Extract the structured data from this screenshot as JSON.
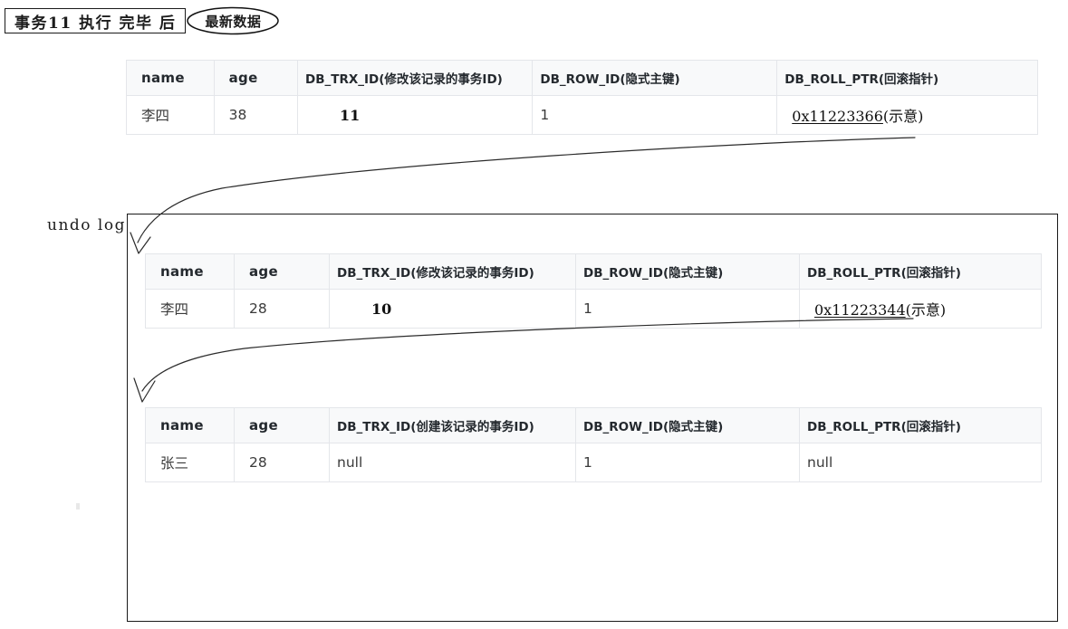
{
  "caption": {
    "boxed_text": "事务11 执行 完毕 后",
    "highlight_text": "最新数据"
  },
  "undo_log": {
    "label": "undo log"
  },
  "tables": {
    "current": {
      "name": "current-record-table",
      "headers": {
        "name": "name",
        "age": "age",
        "trx_id": "DB_TRX_ID(修改该记录的事务ID)",
        "row_id": "DB_ROW_ID(隐式主键)",
        "roll_ptr": "DB_ROLL_PTR(回滚指针)"
      },
      "row": {
        "name": "李四",
        "age": "38",
        "trx_id": "11",
        "row_id": "1",
        "roll_ptr_link": "0x11223366",
        "roll_ptr_note": "(示意)"
      }
    },
    "undo_1": {
      "name": "undo-log-record-table-1",
      "headers": {
        "name": "name",
        "age": "age",
        "trx_id": "DB_TRX_ID(修改该记录的事务ID)",
        "row_id": "DB_ROW_ID(隐式主键)",
        "roll_ptr": "DB_ROLL_PTR(回滚指针)"
      },
      "row": {
        "name": "李四",
        "age": "28",
        "trx_id": "10",
        "row_id": "1",
        "roll_ptr_link": "0x11223344",
        "roll_ptr_note": "(示意)"
      }
    },
    "undo_2": {
      "name": "undo-log-record-table-2",
      "headers": {
        "name": "name",
        "age": "age",
        "trx_id": "DB_TRX_ID(创建该记录的事务ID)",
        "row_id": "DB_ROW_ID(隐式主键)",
        "roll_ptr": "DB_ROLL_PTR(回滚指针)"
      },
      "row": {
        "name": "张三",
        "age": "28",
        "trx_id": "null",
        "row_id": "1",
        "roll_ptr_link": "null",
        "roll_ptr_note": ""
      }
    }
  },
  "colors": {
    "header_bg": "#f8f9fa",
    "cell_border": "#e4e6ea",
    "outline": "#1a1a1a",
    "text": "#1c1c1c"
  }
}
